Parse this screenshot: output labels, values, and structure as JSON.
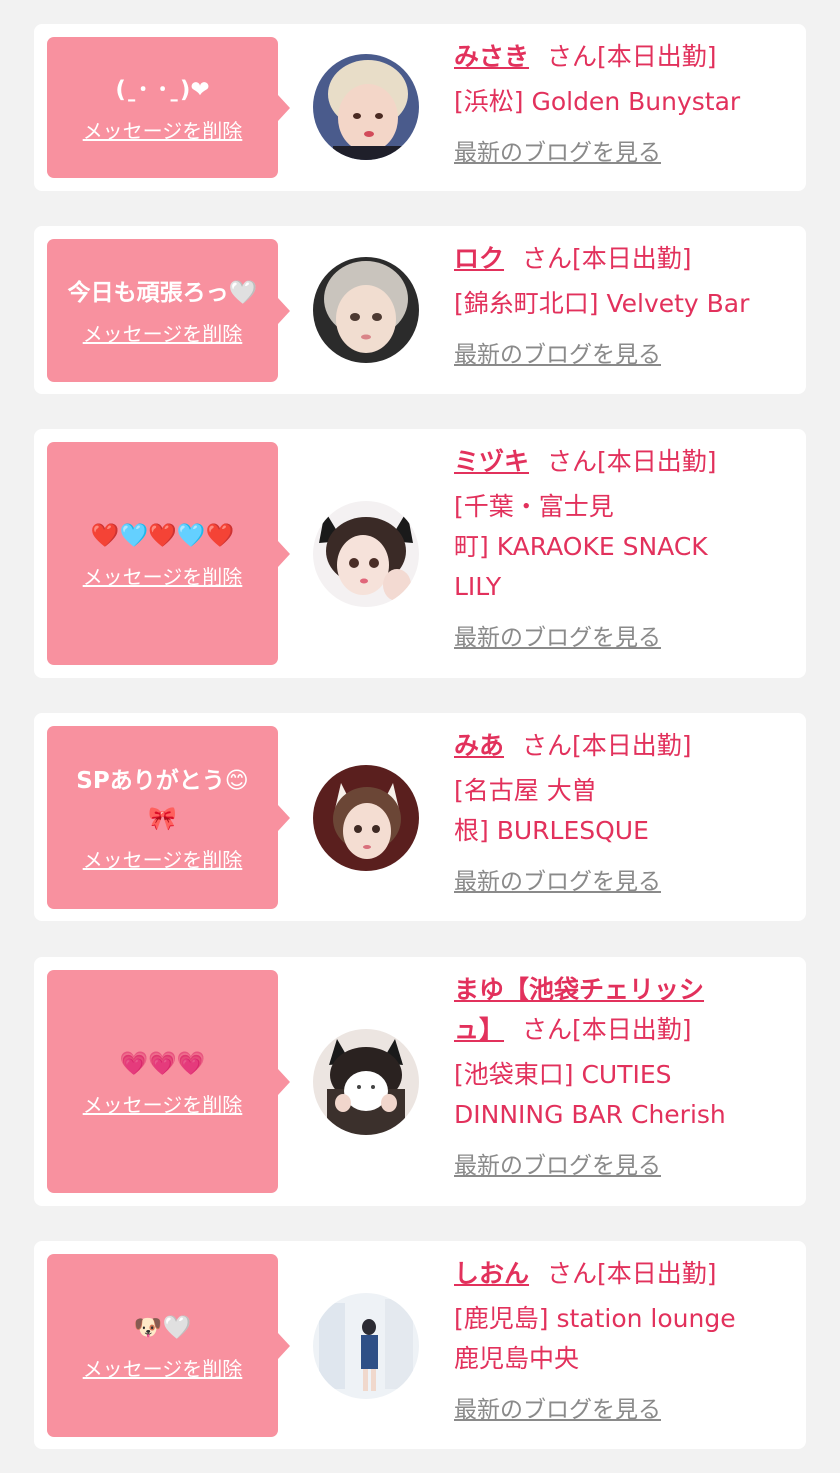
{
  "colors": {
    "accent": "#e2315c",
    "bubble": "#f8919f",
    "muted": "#8a8a8a",
    "background": "#f2f2f2",
    "card": "#ffffff"
  },
  "delete_label": "メッセージを削除",
  "blog_label": "最新のブログを見る",
  "honorific": "さん[本日出勤]",
  "cards": [
    {
      "message": [
        "(ˍ･ ･ˍ)❤"
      ],
      "name": "みさき",
      "shop": [
        "[浜松] Golden Bunystar"
      ]
    },
    {
      "message": [
        "今日も頑張ろっ🤍"
      ],
      "name": "ロク",
      "shop": [
        "[錦糸町北口] Velvety Bar"
      ]
    },
    {
      "message": [
        "❤️🩵❤️🩵❤️"
      ],
      "name": "ミヅキ",
      "shop": [
        "[千葉・富士見",
        "町] KARAOKE SNACK",
        "LILY"
      ]
    },
    {
      "message": [
        "SPありがとう😊",
        "🎀"
      ],
      "name": "みあ",
      "shop": [
        "[名古屋 大曽",
        "根] BURLESQUE"
      ]
    },
    {
      "message": [
        "💗💗💗"
      ],
      "name": [
        "まゆ【池袋チェリッシ",
        "ュ】"
      ],
      "shop": [
        "[池袋東口] CUTIES",
        "DINNING BAR Cherish"
      ]
    },
    {
      "message": [
        "🐶🤍"
      ],
      "name": "しおん",
      "shop": [
        "[鹿児島] station lounge",
        "鹿児島中央"
      ]
    }
  ]
}
